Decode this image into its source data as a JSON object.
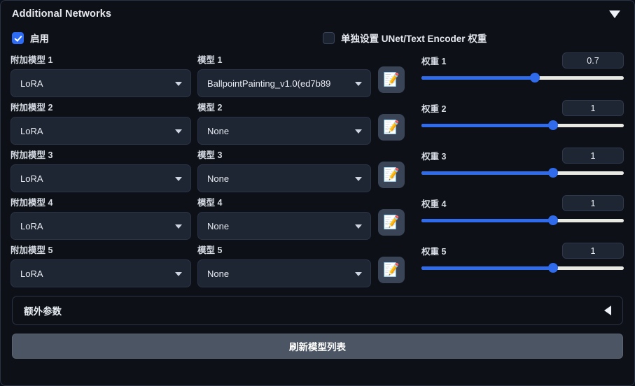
{
  "panel": {
    "title": "Additional Networks",
    "collapse_icon": "triangle-down"
  },
  "enable_checkbox": {
    "label": "启用",
    "checked": true
  },
  "separate_weights_checkbox": {
    "label": "单独设置 UNet/Text Encoder 权重",
    "checked": false
  },
  "labels": {
    "type_prefix": "附加模型",
    "model_prefix": "模型",
    "weight_prefix": "权重"
  },
  "accent_color": "#2f6bea",
  "edit_icon": "📝",
  "rows": [
    {
      "type_label": "附加模型 1",
      "type_value": "LoRA",
      "model_label": "模型 1",
      "model_value": "BallpointPainting_v1.0(ed7b89",
      "weight_label": "权重 1",
      "weight_value": "0.7",
      "weight_percent": 56,
      "edit_icon": "📝"
    },
    {
      "type_label": "附加模型 2",
      "type_value": "LoRA",
      "model_label": "模型 2",
      "model_value": "None",
      "weight_label": "权重 2",
      "weight_value": "1",
      "weight_percent": 65,
      "edit_icon": "📝"
    },
    {
      "type_label": "附加模型 3",
      "type_value": "LoRA",
      "model_label": "模型 3",
      "model_value": "None",
      "weight_label": "权重 3",
      "weight_value": "1",
      "weight_percent": 65,
      "edit_icon": "📝"
    },
    {
      "type_label": "附加模型 4",
      "type_value": "LoRA",
      "model_label": "模型 4",
      "model_value": "None",
      "weight_label": "权重 4",
      "weight_value": "1",
      "weight_percent": 65,
      "edit_icon": "📝"
    },
    {
      "type_label": "附加模型 5",
      "type_value": "LoRA",
      "model_label": "模型 5",
      "model_value": "None",
      "weight_label": "权重 5",
      "weight_value": "1",
      "weight_percent": 65,
      "edit_icon": "📝"
    }
  ],
  "extra_params": {
    "label": "额外参数",
    "expand_icon": "triangle-left"
  },
  "refresh_button": {
    "label": "刷新模型列表"
  }
}
